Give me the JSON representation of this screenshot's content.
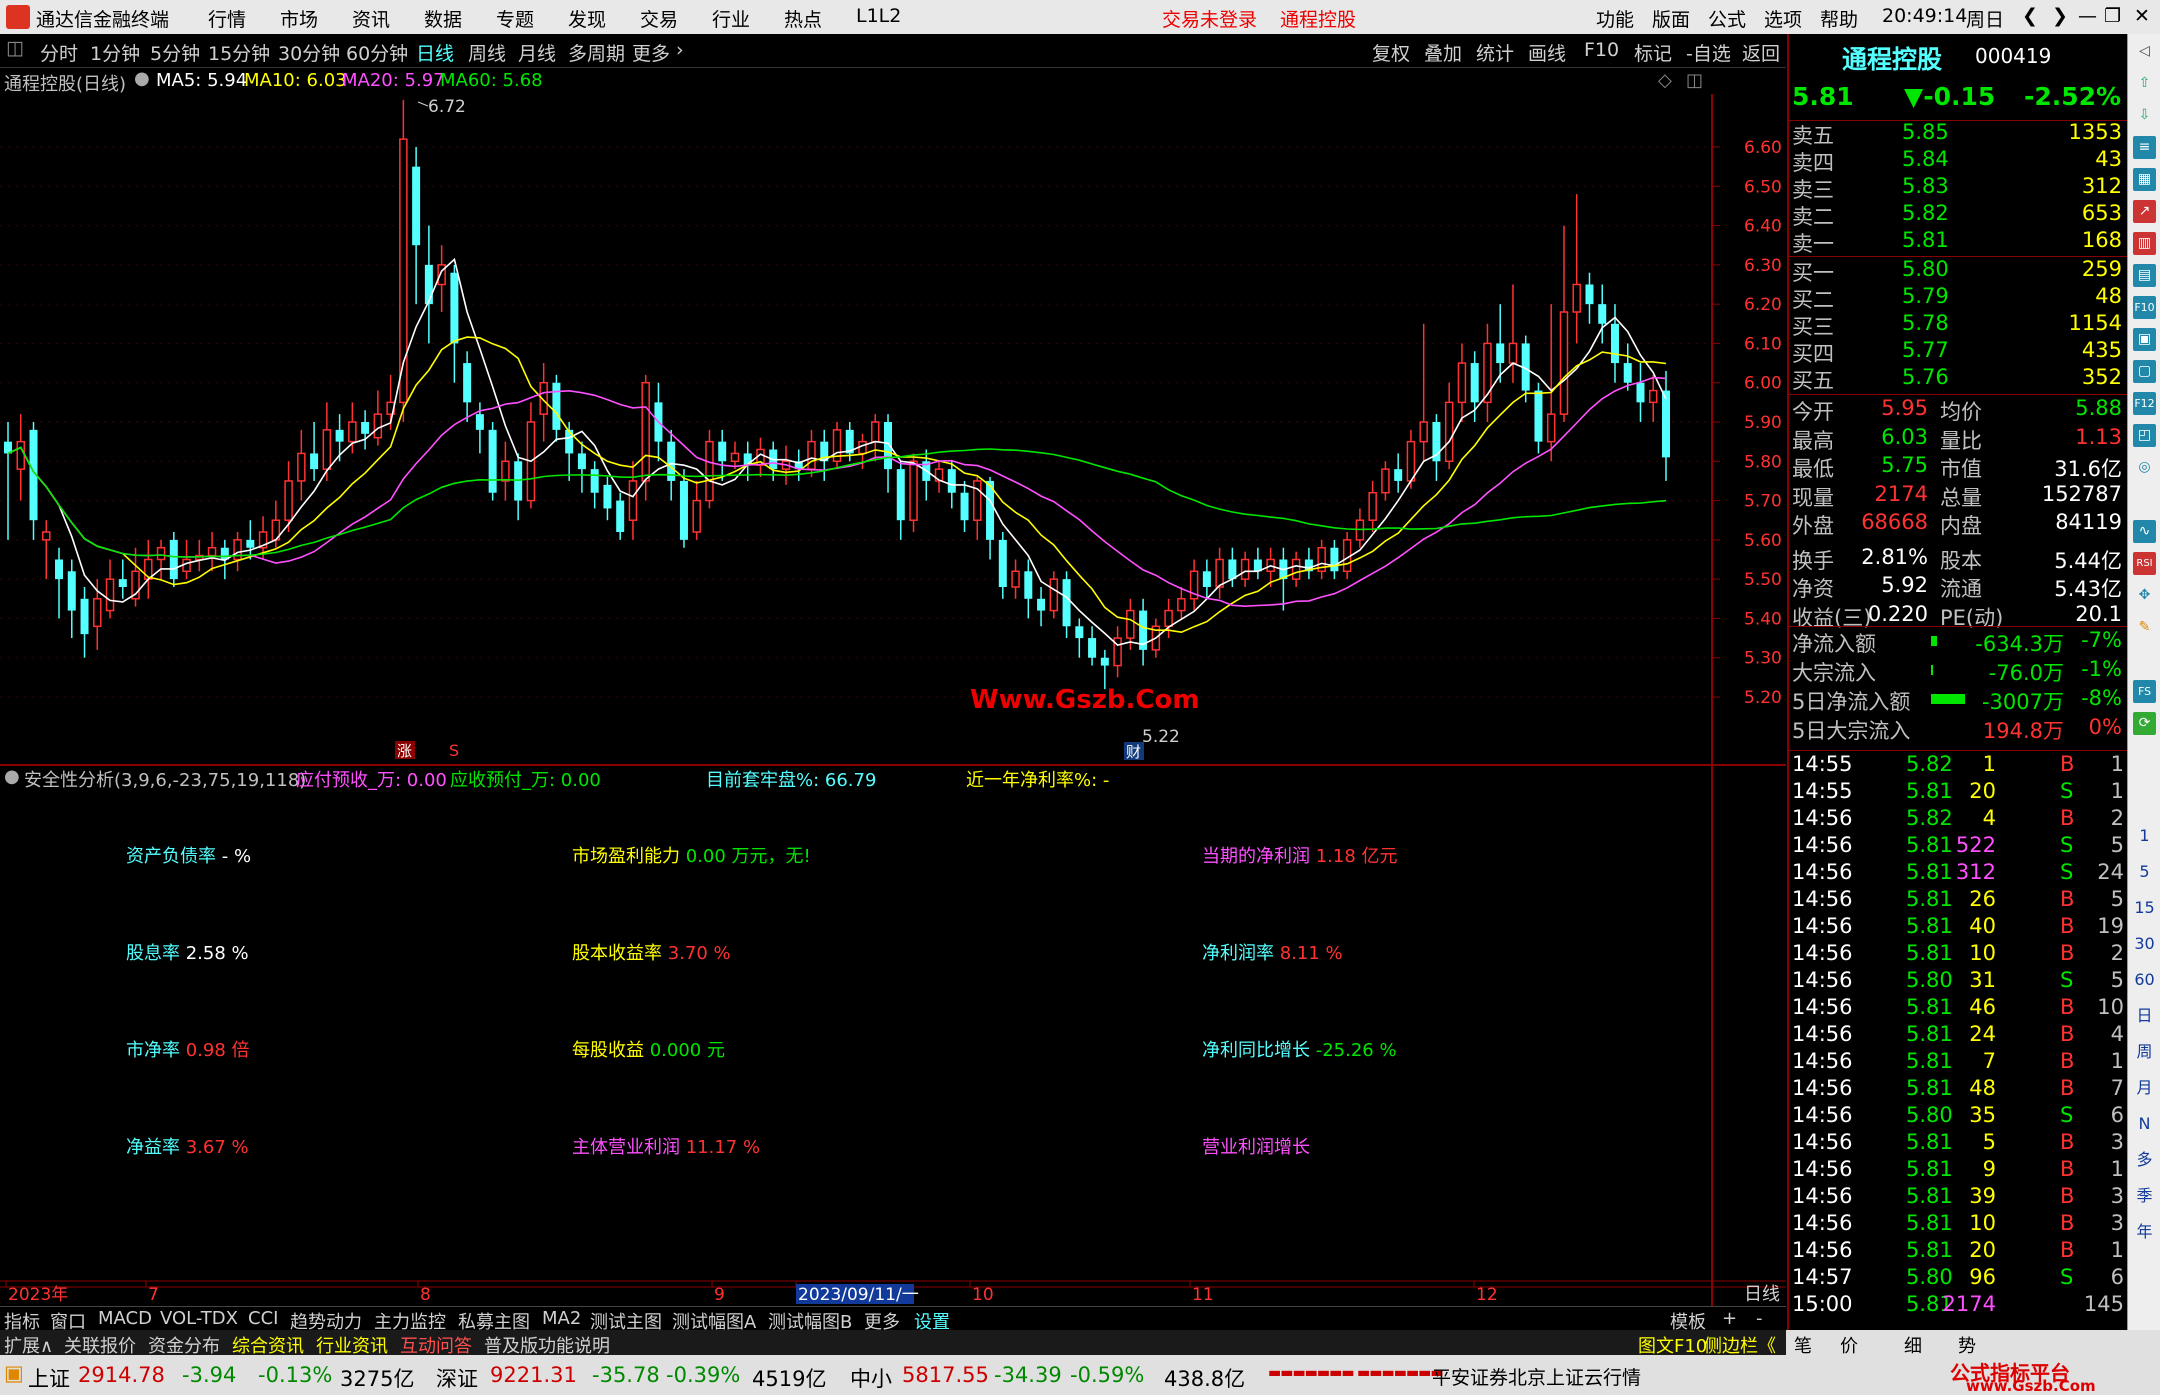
{
  "titlebar": {
    "app": "通达信金融终端",
    "menus": [
      "行情",
      "市场",
      "资讯",
      "数据",
      "专题",
      "发现",
      "交易",
      "行业",
      "热点",
      "L1L2"
    ],
    "login": "交易未登录",
    "stock": "通程控股",
    "right_menus": [
      "功能",
      "版面",
      "公式",
      "选项",
      "帮助"
    ],
    "time": "20:49:14",
    "weekday": "周日"
  },
  "periods": [
    "分时",
    "1分钟",
    "5分钟",
    "15分钟",
    "30分钟",
    "60分钟",
    "日线",
    "周线",
    "月线",
    "多周期",
    "更多"
  ],
  "period_active": "日线",
  "tools": [
    "复权",
    "叠加",
    "统计",
    "画线",
    "F10",
    "标记",
    "-自选",
    "返回"
  ],
  "chartinfo": {
    "name": "通程控股(日线)",
    "ma5": "MA5: 5.94",
    "ma10": "MA10: 6.03",
    "ma20": "MA20: 5.97",
    "ma60": "MA60: 5.68"
  },
  "chart_data": {
    "type": "candlestick",
    "yticks": [
      "6.60",
      "6.50",
      "6.40",
      "6.30",
      "6.20",
      "6.10",
      "6.00",
      "5.90",
      "5.80",
      "5.70",
      "5.60",
      "5.50",
      "5.40",
      "5.30",
      "5.20"
    ],
    "high_label": "6.72",
    "low_label": "5.22",
    "xlabels": [
      "2023年",
      "7",
      "8",
      "9",
      "2023/09/11/一",
      "10",
      "11",
      "12"
    ],
    "period_label": "日线",
    "markers": [
      "涨",
      "S",
      "财"
    ],
    "candles": [
      [
        5.85,
        5.82,
        5.9,
        5.6
      ],
      [
        5.78,
        5.85,
        5.92,
        5.7
      ],
      [
        5.88,
        5.65,
        5.9,
        5.6
      ],
      [
        5.6,
        5.62,
        5.65,
        5.5
      ],
      [
        5.55,
        5.5,
        5.58,
        5.4
      ],
      [
        5.52,
        5.42,
        5.55,
        5.35
      ],
      [
        5.45,
        5.36,
        5.48,
        5.3
      ],
      [
        5.38,
        5.45,
        5.5,
        5.32
      ],
      [
        5.42,
        5.5,
        5.55,
        5.4
      ],
      [
        5.5,
        5.48,
        5.55,
        5.45
      ],
      [
        5.45,
        5.52,
        5.58,
        5.43
      ],
      [
        5.5,
        5.55,
        5.6,
        5.45
      ],
      [
        5.55,
        5.58,
        5.6,
        5.5
      ],
      [
        5.6,
        5.5,
        5.62,
        5.48
      ],
      [
        5.52,
        5.55,
        5.6,
        5.5
      ],
      [
        5.55,
        5.56,
        5.6,
        5.52
      ],
      [
        5.56,
        5.58,
        5.62,
        5.52
      ],
      [
        5.58,
        5.55,
        5.6,
        5.5
      ],
      [
        5.55,
        5.6,
        5.62,
        5.52
      ],
      [
        5.6,
        5.58,
        5.65,
        5.55
      ],
      [
        5.58,
        5.62,
        5.66,
        5.55
      ],
      [
        5.6,
        5.65,
        5.7,
        5.58
      ],
      [
        5.65,
        5.75,
        5.8,
        5.62
      ],
      [
        5.75,
        5.82,
        5.88,
        5.7
      ],
      [
        5.82,
        5.78,
        5.9,
        5.75
      ],
      [
        5.78,
        5.88,
        5.95,
        5.75
      ],
      [
        5.88,
        5.85,
        5.92,
        5.8
      ],
      [
        5.85,
        5.9,
        5.95,
        5.82
      ],
      [
        5.9,
        5.87,
        5.93,
        5.83
      ],
      [
        5.86,
        5.92,
        5.98,
        5.84
      ],
      [
        5.92,
        5.95,
        6.02,
        5.88
      ],
      [
        5.95,
        6.62,
        6.72,
        5.9
      ],
      [
        6.55,
        6.35,
        6.6,
        6.2
      ],
      [
        6.3,
        6.2,
        6.4,
        6.1
      ],
      [
        6.25,
        6.3,
        6.35,
        6.18
      ],
      [
        6.28,
        6.1,
        6.3,
        6.0
      ],
      [
        6.05,
        5.95,
        6.08,
        5.9
      ],
      [
        5.92,
        5.88,
        5.95,
        5.82
      ],
      [
        5.88,
        5.72,
        5.9,
        5.7
      ],
      [
        5.75,
        5.8,
        5.85,
        5.7
      ],
      [
        5.8,
        5.7,
        5.82,
        5.65
      ],
      [
        5.7,
        5.9,
        5.95,
        5.68
      ],
      [
        5.92,
        6.0,
        6.05,
        5.85
      ],
      [
        6.0,
        5.88,
        6.02,
        5.85
      ],
      [
        5.88,
        5.82,
        5.9,
        5.75
      ],
      [
        5.82,
        5.78,
        5.85,
        5.72
      ],
      [
        5.78,
        5.72,
        5.8,
        5.68
      ],
      [
        5.74,
        5.68,
        5.76,
        5.65
      ],
      [
        5.7,
        5.62,
        5.72,
        5.6
      ],
      [
        5.65,
        5.75,
        5.8,
        5.6
      ],
      [
        5.75,
        6.0,
        6.02,
        5.7
      ],
      [
        5.95,
        5.85,
        6.0,
        5.8
      ],
      [
        5.85,
        5.75,
        5.88,
        5.7
      ],
      [
        5.75,
        5.6,
        5.78,
        5.58
      ],
      [
        5.62,
        5.7,
        5.75,
        5.6
      ],
      [
        5.7,
        5.85,
        5.88,
        5.68
      ],
      [
        5.85,
        5.8,
        5.88,
        5.75
      ],
      [
        5.8,
        5.82,
        5.85,
        5.78
      ],
      [
        5.82,
        5.79,
        5.85,
        5.75
      ],
      [
        5.79,
        5.83,
        5.86,
        5.76
      ],
      [
        5.83,
        5.78,
        5.85,
        5.75
      ],
      [
        5.78,
        5.8,
        5.84,
        5.74
      ],
      [
        5.8,
        5.78,
        5.83,
        5.75
      ],
      [
        5.78,
        5.85,
        5.88,
        5.76
      ],
      [
        5.85,
        5.8,
        5.88,
        5.75
      ],
      [
        5.8,
        5.88,
        5.9,
        5.78
      ],
      [
        5.88,
        5.82,
        5.9,
        5.8
      ],
      [
        5.82,
        5.85,
        5.87,
        5.78
      ],
      [
        5.85,
        5.9,
        5.92,
        5.8
      ],
      [
        5.9,
        5.78,
        5.92,
        5.72
      ],
      [
        5.78,
        5.65,
        5.8,
        5.6
      ],
      [
        5.65,
        5.8,
        5.82,
        5.62
      ],
      [
        5.8,
        5.75,
        5.83,
        5.7
      ],
      [
        5.75,
        5.78,
        5.8,
        5.72
      ],
      [
        5.78,
        5.72,
        5.8,
        5.68
      ],
      [
        5.72,
        5.65,
        5.75,
        5.62
      ],
      [
        5.65,
        5.75,
        5.76,
        5.6
      ],
      [
        5.75,
        5.6,
        5.76,
        5.55
      ],
      [
        5.6,
        5.48,
        5.62,
        5.45
      ],
      [
        5.48,
        5.52,
        5.55,
        5.45
      ],
      [
        5.52,
        5.45,
        5.55,
        5.4
      ],
      [
        5.45,
        5.42,
        5.48,
        5.38
      ],
      [
        5.42,
        5.5,
        5.52,
        5.4
      ],
      [
        5.5,
        5.38,
        5.52,
        5.35
      ],
      [
        5.38,
        5.35,
        5.4,
        5.3
      ],
      [
        5.35,
        5.3,
        5.38,
        5.28
      ],
      [
        5.3,
        5.28,
        5.32,
        5.22
      ],
      [
        5.28,
        5.35,
        5.38,
        5.25
      ],
      [
        5.35,
        5.42,
        5.45,
        5.32
      ],
      [
        5.42,
        5.32,
        5.45,
        5.28
      ],
      [
        5.32,
        5.38,
        5.4,
        5.3
      ],
      [
        5.38,
        5.42,
        5.45,
        5.35
      ],
      [
        5.42,
        5.45,
        5.48,
        5.4
      ],
      [
        5.45,
        5.52,
        5.55,
        5.42
      ],
      [
        5.52,
        5.48,
        5.55,
        5.45
      ],
      [
        5.48,
        5.55,
        5.58,
        5.45
      ],
      [
        5.55,
        5.5,
        5.58,
        5.48
      ],
      [
        5.5,
        5.55,
        5.57,
        5.48
      ],
      [
        5.55,
        5.52,
        5.58,
        5.5
      ],
      [
        5.52,
        5.55,
        5.58,
        5.48
      ],
      [
        5.55,
        5.5,
        5.58,
        5.42
      ],
      [
        5.5,
        5.55,
        5.57,
        5.48
      ],
      [
        5.55,
        5.52,
        5.58,
        5.5
      ],
      [
        5.52,
        5.58,
        5.6,
        5.5
      ],
      [
        5.58,
        5.52,
        5.6,
        5.5
      ],
      [
        5.52,
        5.6,
        5.62,
        5.5
      ],
      [
        5.6,
        5.65,
        5.68,
        5.58
      ],
      [
        5.65,
        5.72,
        5.75,
        5.62
      ],
      [
        5.72,
        5.78,
        5.8,
        5.7
      ],
      [
        5.78,
        5.75,
        5.82,
        5.72
      ],
      [
        5.75,
        5.85,
        5.88,
        5.73
      ],
      [
        5.85,
        5.9,
        6.15,
        5.8
      ],
      [
        5.9,
        5.8,
        5.92,
        5.75
      ],
      [
        5.8,
        5.95,
        6.0,
        5.78
      ],
      [
        5.95,
        6.05,
        6.1,
        5.9
      ],
      [
        6.05,
        5.95,
        6.08,
        5.9
      ],
      [
        5.95,
        6.1,
        6.15,
        5.9
      ],
      [
        6.1,
        6.05,
        6.2,
        6.0
      ],
      [
        6.05,
        6.1,
        6.25,
        6.0
      ],
      [
        6.1,
        5.98,
        6.12,
        5.95
      ],
      [
        5.98,
        5.85,
        6.0,
        5.82
      ],
      [
        5.85,
        5.92,
        6.2,
        5.8
      ],
      [
        5.92,
        6.18,
        6.4,
        5.9
      ],
      [
        6.18,
        6.25,
        6.48,
        6.1
      ],
      [
        6.25,
        6.2,
        6.28,
        6.15
      ],
      [
        6.2,
        6.15,
        6.25,
        6.1
      ],
      [
        6.15,
        6.05,
        6.2,
        6.0
      ],
      [
        6.05,
        6.0,
        6.1,
        5.98
      ],
      [
        6.0,
        5.95,
        6.05,
        5.9
      ],
      [
        5.95,
        5.98,
        6.02,
        5.9
      ],
      [
        5.98,
        5.81,
        6.03,
        5.75
      ]
    ]
  },
  "indicator": {
    "title": "安全性分析(3,9,6,-23,75,19,118)",
    "p1": "应付预收_万: 0.00",
    "p2": "应收预付_万: 0.00",
    "p3": "目前套牢盘%: 66.79",
    "p4": "近一年净利率%: -"
  },
  "fin": {
    "c1": [
      [
        "资产负债率",
        " - %"
      ],
      [
        "股息率",
        " 2.58 %"
      ],
      [
        "市净率",
        " 0.98 倍"
      ],
      [
        "净益率",
        " 3.67 %"
      ]
    ],
    "c2": [
      [
        "市场盈利能力",
        " 0.00 万元，无!"
      ],
      [
        "股本收益率",
        " 3.70 %"
      ],
      [
        "每股收益",
        " 0.000 元"
      ],
      [
        "主体营业利润",
        " 11.17 %"
      ]
    ],
    "c3": [
      [
        "当期的净利润",
        " 1.18 亿元"
      ],
      [
        "净利润率",
        " 8.11 %"
      ],
      [
        "净利同比增长",
        " -25.26 %"
      ],
      [
        "营业利润增长",
        ""
      ]
    ]
  },
  "watermark": "Www.Gszb.Com",
  "quote": {
    "name": "通程控股",
    "code": "000419",
    "price": "5.81",
    "change": "▼-0.15",
    "pct": "-2.52%",
    "asks": [
      [
        "卖五",
        "5.85",
        "1353"
      ],
      [
        "卖四",
        "5.84",
        "43"
      ],
      [
        "卖三",
        "5.83",
        "312"
      ],
      [
        "卖二",
        "5.82",
        "653"
      ],
      [
        "卖一",
        "5.81",
        "168"
      ]
    ],
    "bids": [
      [
        "买一",
        "5.80",
        "259"
      ],
      [
        "买二",
        "5.79",
        "48"
      ],
      [
        "买三",
        "5.78",
        "1154"
      ],
      [
        "买四",
        "5.77",
        "435"
      ],
      [
        "买五",
        "5.76",
        "352"
      ]
    ],
    "stats": [
      [
        "今开",
        "5.95",
        "均价",
        "5.88"
      ],
      [
        "最高",
        "6.03",
        "量比",
        "1.13"
      ],
      [
        "最低",
        "5.75",
        "市值",
        "31.6亿"
      ],
      [
        "现量",
        "2174",
        "总量",
        "152787"
      ],
      [
        "外盘",
        "68668",
        "内盘",
        "84119"
      ],
      [
        "换手",
        "2.81%",
        "股本",
        "5.44亿"
      ],
      [
        "净资",
        "5.92",
        "流通",
        "5.43亿"
      ],
      [
        "收益(三)",
        "0.220",
        "PE(动)",
        "20.1"
      ]
    ],
    "flows": [
      [
        "净流入额",
        "-634.3万",
        "-7%"
      ],
      [
        "大宗流入",
        "-76.0万",
        "-1%"
      ],
      [
        "5日净流入额",
        "-3007万",
        "-8%"
      ],
      [
        "5日大宗流入",
        "194.8万",
        "0%"
      ]
    ],
    "ticks": [
      [
        "14:55",
        "5.82",
        "1",
        "B",
        "1"
      ],
      [
        "14:55",
        "5.81",
        "20",
        "S",
        "1"
      ],
      [
        "14:56",
        "5.82",
        "4",
        "B",
        "2"
      ],
      [
        "14:56",
        "5.81",
        "522",
        "S",
        "5"
      ],
      [
        "14:56",
        "5.81",
        "312",
        "S",
        "24"
      ],
      [
        "14:56",
        "5.81",
        "26",
        "B",
        "5"
      ],
      [
        "14:56",
        "5.81",
        "40",
        "B",
        "19"
      ],
      [
        "14:56",
        "5.81",
        "10",
        "B",
        "2"
      ],
      [
        "14:56",
        "5.80",
        "31",
        "S",
        "5"
      ],
      [
        "14:56",
        "5.81",
        "46",
        "B",
        "10"
      ],
      [
        "14:56",
        "5.81",
        "24",
        "B",
        "4"
      ],
      [
        "14:56",
        "5.81",
        "7",
        "B",
        "1"
      ],
      [
        "14:56",
        "5.81",
        "48",
        "B",
        "7"
      ],
      [
        "14:56",
        "5.80",
        "35",
        "S",
        "6"
      ],
      [
        "14:56",
        "5.81",
        "5",
        "B",
        "3"
      ],
      [
        "14:56",
        "5.81",
        "9",
        "B",
        "1"
      ],
      [
        "14:56",
        "5.81",
        "39",
        "B",
        "3"
      ],
      [
        "14:56",
        "5.81",
        "10",
        "B",
        "3"
      ],
      [
        "14:56",
        "5.81",
        "20",
        "B",
        "1"
      ],
      [
        "14:57",
        "5.80",
        "96",
        "S",
        "6"
      ],
      [
        "15:00",
        "5.81",
        "2174",
        "",
        "145"
      ]
    ]
  },
  "bottomtabs": [
    "指标",
    "窗口",
    "MACD",
    "VOL-TDX",
    "CCI",
    "趋势动力",
    "主力监控",
    "私募主图",
    "MA2",
    "测试主图",
    "测试幅图A",
    "测试幅图B",
    "更多",
    "设置",
    "模板",
    "+",
    "-"
  ],
  "extbar": [
    "扩展∧",
    "关联报价",
    "资金分布",
    "综合资讯",
    "行业资讯",
    "互动问答",
    "普及版功能说明",
    "图文F10",
    "侧边栏《",
    "笔",
    "价",
    "细",
    "势"
  ],
  "status": {
    "sh_name": "上证",
    "sh": "2914.78",
    "sh_chg": "-3.94",
    "sh_pct": "-0.13%",
    "sh_amt": "3275亿",
    "sz_name": "深证",
    "sz": "9221.31",
    "sz_chg": "-35.78",
    "sz_pct": "-0.39%",
    "sz_amt": "4519亿",
    "zx_name": "中小",
    "zx": "5817.55",
    "zx_chg": "-34.39",
    "zx_pct": "-0.59%",
    "zx_amt": "438.8亿",
    "broker": "平安证券北京上证云行情",
    "site": "公式指标平台",
    "site_url": "www.Gszb.Com"
  },
  "sidebar_icons": [
    "up-icon",
    "down-icon",
    "list-icon",
    "chart-icon",
    "f10-icon",
    "rsi-icon",
    "settings-icon"
  ],
  "sidebar_labels": [
    "1",
    "5",
    "15",
    "30",
    "60",
    "日",
    "周",
    "月",
    "N",
    "多",
    "季",
    "年"
  ]
}
